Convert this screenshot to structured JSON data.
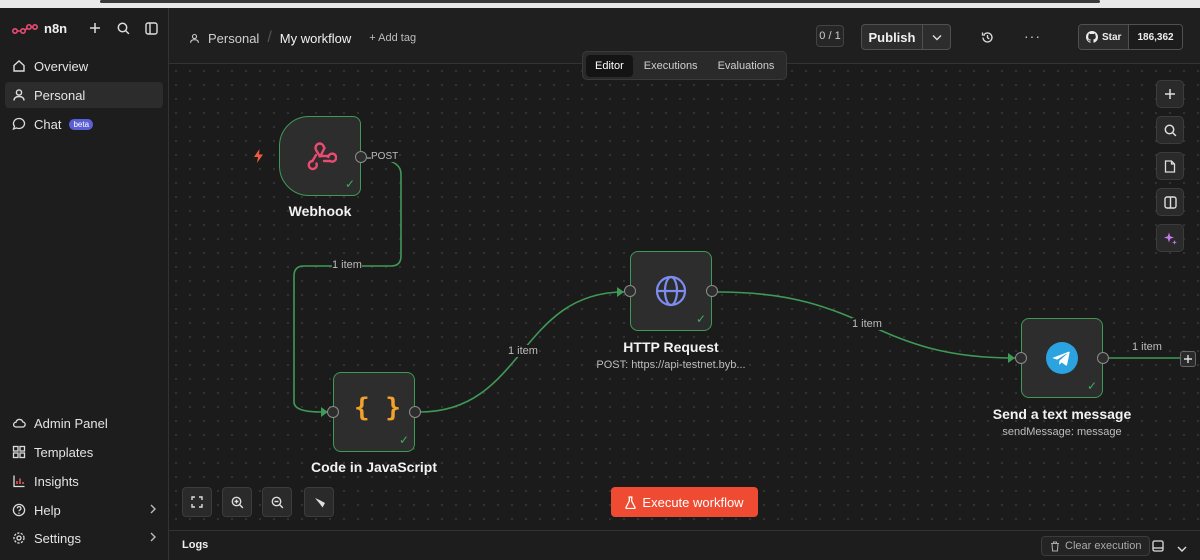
{
  "brand": {
    "name": "n8n"
  },
  "sidebar": {
    "items": [
      {
        "label": "Overview",
        "icon": "home-icon"
      },
      {
        "label": "Personal",
        "icon": "user-icon"
      },
      {
        "label": "Chat",
        "icon": "chat-icon",
        "badge": "beta"
      }
    ],
    "bottom_items": [
      {
        "label": "Admin Panel",
        "icon": "cloud-icon"
      },
      {
        "label": "Templates",
        "icon": "templates-icon"
      },
      {
        "label": "Insights",
        "icon": "insights-icon"
      },
      {
        "label": "Help",
        "icon": "help-icon"
      },
      {
        "label": "Settings",
        "icon": "settings-icon"
      }
    ]
  },
  "header": {
    "breadcrumb_project": "Personal",
    "workflow_name": "My workflow",
    "add_tag": "+ Add tag",
    "counter": "0 / 1",
    "publish_label": "Publish",
    "github_star": "Star",
    "github_count": "186,362"
  },
  "tabs": [
    {
      "label": "Editor",
      "active": true
    },
    {
      "label": "Executions",
      "active": false
    },
    {
      "label": "Evaluations",
      "active": false
    }
  ],
  "nodes": {
    "webhook": {
      "title": "Webhook",
      "output_label": "POST"
    },
    "code": {
      "title": "Code in JavaScript"
    },
    "http": {
      "title": "HTTP Request",
      "subtitle": "POST: https://api-testnet.byb..."
    },
    "telegram": {
      "title": "Send a text message",
      "subtitle": "sendMessage: message"
    }
  },
  "edges": [
    {
      "label": "1 item"
    },
    {
      "label": "1 item"
    },
    {
      "label": "1 item"
    },
    {
      "label": "1 item"
    }
  ],
  "execute_label": "Execute workflow",
  "logs": {
    "title": "Logs",
    "clear_label": "Clear execution"
  },
  "colors": {
    "accent": "#ef4a32",
    "success": "#3f9a58",
    "bg": "#1b1b1b"
  }
}
